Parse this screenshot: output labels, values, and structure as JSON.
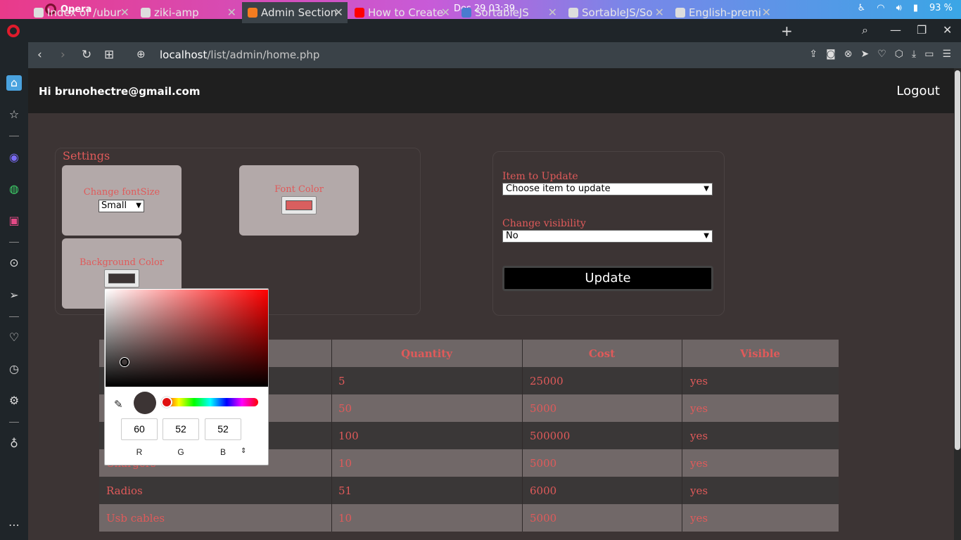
{
  "system_bar": {
    "app_name": "Opera",
    "clock": "Des 29  03:39",
    "battery": "93 %"
  },
  "tabs": [
    {
      "title": "Index of /ubur",
      "icon": "globe-icon",
      "active": false
    },
    {
      "title": "ziki-amp",
      "icon": "speaker-icon",
      "active": false
    },
    {
      "title": "Admin Section",
      "icon": "xampp-icon",
      "active": true
    },
    {
      "title": "How to Create",
      "icon": "youtube-icon",
      "active": false
    },
    {
      "title": "SortableJS",
      "icon": "sortable-icon",
      "active": false
    },
    {
      "title": "SortableJS/So",
      "icon": "github-icon",
      "active": false
    },
    {
      "title": "English-premi",
      "icon": "github-icon",
      "active": false
    }
  ],
  "address": {
    "host": "localhost",
    "path": "/list/admin/home.php"
  },
  "header": {
    "greeting": "Hi brunohectre@gmail.com",
    "logout": "Logout"
  },
  "settings": {
    "title": "Settings",
    "font_size_label": "Change fontSize",
    "font_size_value": "Small",
    "font_color_label": "Font Color",
    "font_color": "#d95f5f",
    "background_color_label": "Background Color",
    "background_color": "#3c3434"
  },
  "update_form": {
    "item_label": "Item to Update",
    "item_value": "Choose item to update",
    "visibility_label": "Change visibility",
    "visibility_value": "No",
    "update_button": "Update"
  },
  "table": {
    "headers": [
      "",
      "Quantity",
      "Cost",
      "Visible"
    ],
    "rows": [
      [
        "",
        "5",
        "25000",
        "yes"
      ],
      [
        "",
        "50",
        "5000",
        "yes"
      ],
      [
        "",
        "100",
        "500000",
        "yes"
      ],
      [
        "Chargers",
        "10",
        "5000",
        "yes"
      ],
      [
        "Radios",
        "51",
        "6000",
        "yes"
      ],
      [
        "Usb cables",
        "10",
        "5000",
        "yes"
      ]
    ]
  },
  "color_picker": {
    "r": "60",
    "g": "52",
    "b": "52",
    "r_label": "R",
    "g_label": "G",
    "b_label": "B",
    "preview_color": "#3c3434"
  }
}
